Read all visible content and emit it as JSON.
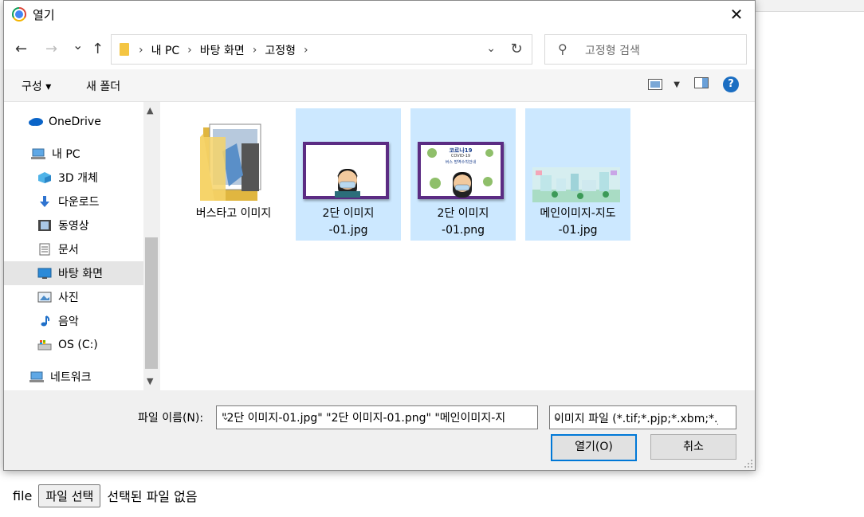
{
  "dialog": {
    "title": "열기",
    "close_label": "✕"
  },
  "nav": {
    "back": "←",
    "forward": "→",
    "recent": "⌄",
    "up": "↑",
    "breadcrumb": [
      "내 PC",
      "바탕 화면",
      "고정형"
    ],
    "refresh": "↻",
    "search_placeholder": "고정형 검색"
  },
  "commands": {
    "organize": "구성 ▾",
    "new_folder": "새 폴더",
    "help": "?"
  },
  "sidebar": {
    "items": [
      {
        "label": "OneDrive",
        "icon": "onedrive-icon"
      },
      {
        "label": "내 PC",
        "icon": "pc-icon"
      },
      {
        "label": "3D 개체",
        "icon": "3d-objects-icon"
      },
      {
        "label": "다운로드",
        "icon": "download-icon"
      },
      {
        "label": "동영상",
        "icon": "video-icon"
      },
      {
        "label": "문서",
        "icon": "document-icon"
      },
      {
        "label": "바탕 화면",
        "icon": "desktop-icon",
        "selected": true
      },
      {
        "label": "사진",
        "icon": "pictures-icon"
      },
      {
        "label": "음악",
        "icon": "music-icon"
      },
      {
        "label": "OS (C:)",
        "icon": "drive-icon"
      },
      {
        "label": "네트워크",
        "icon": "network-icon"
      }
    ]
  },
  "files": [
    {
      "line1": "버스타고 이미지",
      "line2": "",
      "type": "folder",
      "selected": false
    },
    {
      "line1": "2단 이미지",
      "line2": "-01.jpg",
      "type": "image",
      "selected": true
    },
    {
      "line1": "2단 이미지",
      "line2": "-01.png",
      "type": "image",
      "selected": true
    },
    {
      "line1": "메인이미지-지도",
      "line2": "-01.jpg",
      "type": "image",
      "selected": true
    }
  ],
  "thumb_texts": {
    "covid_title": "코로나19",
    "covid_sub": "COVID-19",
    "covid_line": "버스 방역수칙안내"
  },
  "footer": {
    "filename_label": "파일 이름(N):",
    "filename_value": "\"2단 이미지-01.jpg\" \"2단 이미지-01.png\" \"메인이미지-지",
    "filetype_value": "이미지 파일 (*.tif;*.pjp;*.xbm;*.jxl",
    "open_button": "열기(O)",
    "cancel_button": "취소"
  },
  "page": {
    "file_label": "file",
    "choose_button": "파일 선택",
    "no_file_text": "선택된 파일 없음"
  },
  "colors": {
    "accent": "#0078d7",
    "selection": "#cce8ff",
    "help": "#1b6ec2"
  }
}
